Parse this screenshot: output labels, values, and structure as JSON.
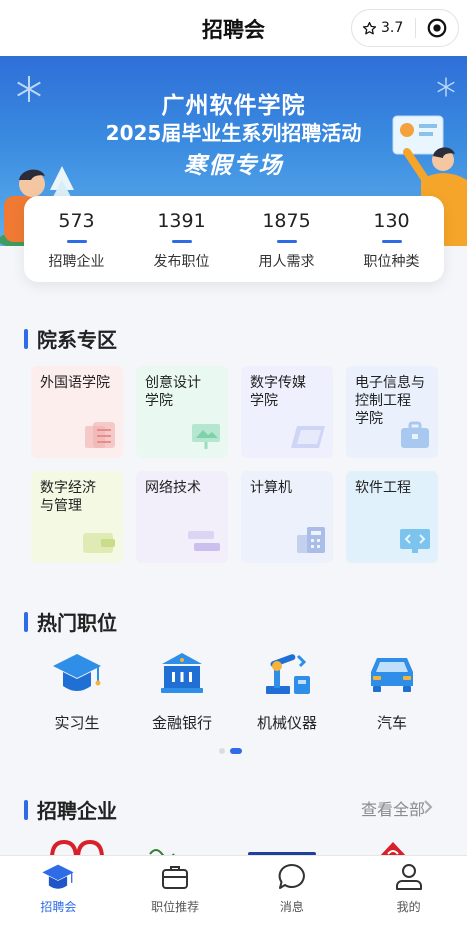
{
  "header": {
    "title": "招聘会",
    "rating": "3.7"
  },
  "banner": {
    "line1": "广州软件学院",
    "line2": "2025届毕业生系列招聘活动",
    "line3": "寒假专场"
  },
  "stats": [
    {
      "value": "573",
      "label": "招聘企业"
    },
    {
      "value": "1391",
      "label": "发布职位"
    },
    {
      "value": "1875",
      "label": "用人需求"
    },
    {
      "value": "130",
      "label": "职位种类"
    }
  ],
  "departments": {
    "title": "院系专区",
    "items": [
      {
        "label": "外国语学院",
        "color": "#fdeeee"
      },
      {
        "label": "创意设计\n学院",
        "color": "#e9f8f1"
      },
      {
        "label": "数字传媒\n学院",
        "color": "#eef0fd"
      },
      {
        "label": "电子信息与\n控制工程\n学院",
        "color": "#eaf1fd"
      },
      {
        "label": "数字经济\n与管理",
        "color": "#f4f9e4"
      },
      {
        "label": "网络技术",
        "color": "#f2effb"
      },
      {
        "label": "计算机",
        "color": "#ecf1fb"
      },
      {
        "label": "软件工程",
        "color": "#e1f1fc"
      }
    ]
  },
  "hot_positions": {
    "title": "热门职位",
    "items": [
      {
        "label": "实习生",
        "icon": "graduation-cap-icon"
      },
      {
        "label": "金融银行",
        "icon": "bank-icon"
      },
      {
        "label": "机械仪器",
        "icon": "robot-arm-icon"
      },
      {
        "label": "汽车",
        "icon": "car-icon"
      }
    ],
    "page": 2,
    "pages": 2
  },
  "companies": {
    "title": "招聘企业",
    "view_all": "查看全部"
  },
  "tabbar": [
    {
      "label": "招聘会",
      "active": true
    },
    {
      "label": "职位推荐",
      "active": false
    },
    {
      "label": "消息",
      "active": false
    },
    {
      "label": "我的",
      "active": false
    }
  ],
  "colors": {
    "accent": "#2e6be6",
    "banner": "#3a8be0"
  }
}
